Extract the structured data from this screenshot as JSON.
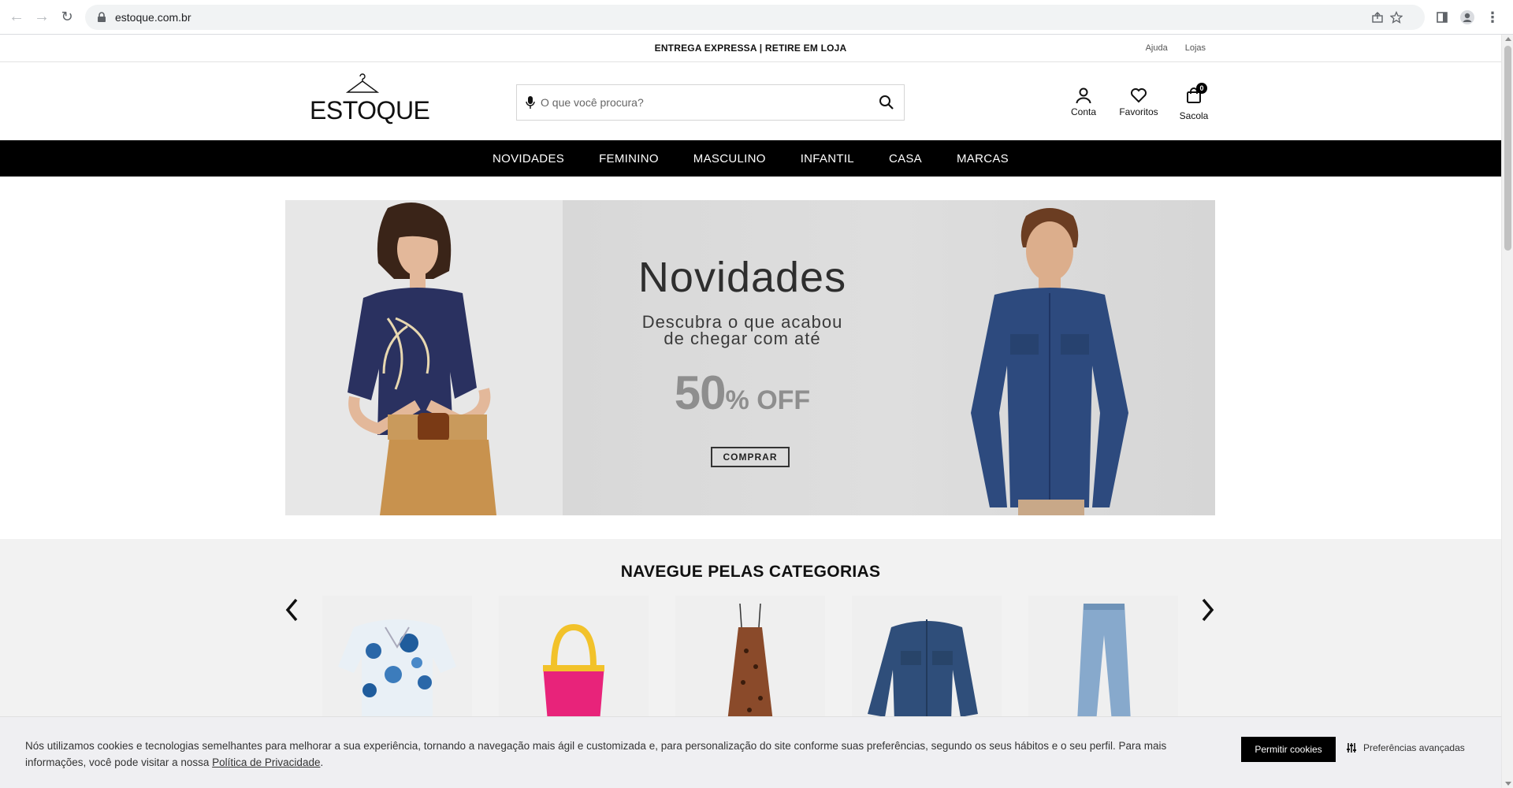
{
  "browser": {
    "url": "estoque.com.br"
  },
  "topbar": {
    "promo": "ENTREGA EXPRESSA | RETIRE EM LOJA",
    "help": "Ajuda",
    "stores": "Lojas"
  },
  "header": {
    "logo_text": "ESTOQUE",
    "search_placeholder": "O que você procura?",
    "account": "Conta",
    "favorites": "Favoritos",
    "bag": "Sacola",
    "bag_count": "0"
  },
  "nav": {
    "items": [
      "NOVIDADES",
      "FEMININO",
      "MASCULINO",
      "INFANTIL",
      "CASA",
      "MARCAS"
    ]
  },
  "hero": {
    "title": "Novidades",
    "subtitle_line1": "Descubra o que acabou",
    "subtitle_line2": "de chegar com até",
    "percent": "50",
    "percent_suffix": "% OFF",
    "cta": "COMPRAR"
  },
  "categories": {
    "title": "NAVEGUE PELAS CATEGORIAS",
    "items": [
      "floral-dress",
      "pink-crochet-bag",
      "leopard-slip-dress",
      "denim-jacket",
      "light-jeans"
    ]
  },
  "cookie": {
    "text": "Nós utilizamos cookies e tecnologias semelhantes para melhorar a sua experiência, tornando a navegação mais ágil e customizada e, para personalização do site conforme suas preferências, segundo os seus hábitos e o seu perfil. Para mais informações, você pode visitar a nossa",
    "link": "Política de Privacidade",
    "text_end": ".",
    "allow": "Permitir cookies",
    "prefs": "Preferências avançadas"
  },
  "colors": {
    "nav_bg": "#000000",
    "accent": "#000000",
    "hero_bg": "#dcdcdc",
    "cookie_bg": "#efeff2"
  }
}
